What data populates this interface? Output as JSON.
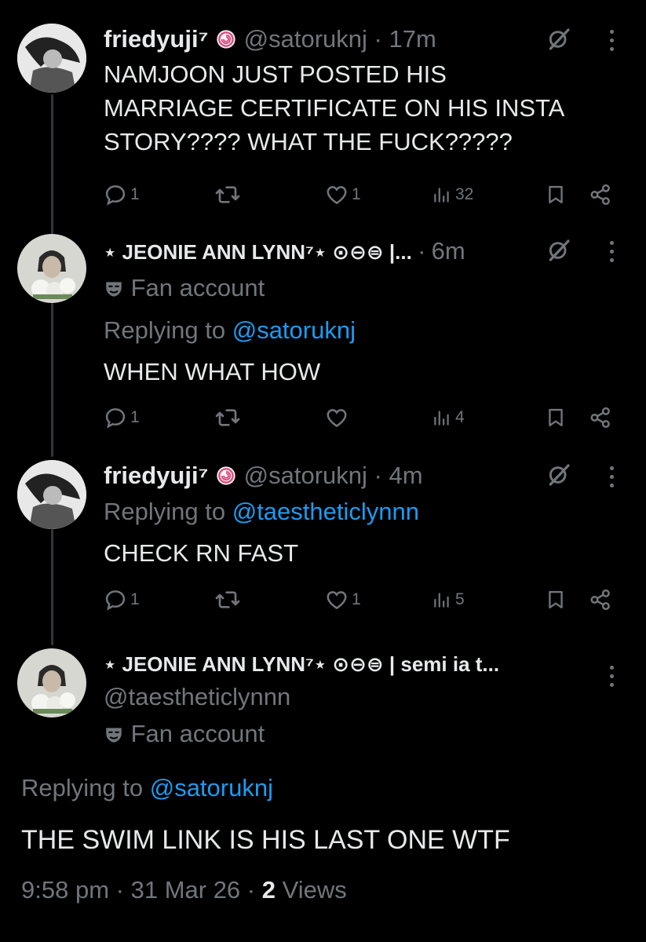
{
  "tweets": [
    {
      "display_name": "friedyuji⁷",
      "handle": "@satoruknj",
      "time_sep": "·",
      "time": "17m",
      "text_lines": [
        "NAMJOON JUST POSTED HIS",
        "MARRIAGE CERTIFICATE ON HIS INSTA",
        "STORY???? WHAT THE FUCK?????"
      ],
      "replies": "1",
      "likes": "1",
      "views": "32"
    },
    {
      "display_name": "⋆ JEONIE ANN LYNN⁷⋆ ⊙⊖⊜ |...",
      "time_sep": "·",
      "time": "6m",
      "label": "Fan account",
      "replying_prefix": "Replying to ",
      "replying_handle": "@satoruknj",
      "text": "WHEN WHAT HOW",
      "replies": "1",
      "views": "4"
    },
    {
      "display_name": "friedyuji⁷",
      "handle": "@satoruknj",
      "time_sep": "·",
      "time": "4m",
      "replying_prefix": "Replying to ",
      "replying_handle": "@taestheticlynnn",
      "text": "CHECK RN FAST",
      "replies": "1",
      "likes": "1",
      "views": "5"
    }
  ],
  "main": {
    "display_name": "⋆ JEONIE ANN LYNN⁷⋆ ⊙⊖⊜ | semi ia t...",
    "handle": "@taestheticlynnn",
    "label": "Fan account",
    "replying_prefix": "Replying to ",
    "replying_handle": "@satoruknj",
    "text": "THE SWIM LINK IS HIS LAST ONE WTF",
    "time": "9:58 pm",
    "sep1": "·",
    "date": "31 Mar 26",
    "sep2": "·",
    "views_count": "2",
    "views_label": "Views"
  },
  "icons": {
    "reply": "reply-icon",
    "retweet": "retweet-icon",
    "like": "heart-icon",
    "views": "views-icon",
    "bookmark": "bookmark-icon",
    "share": "share-icon",
    "grok": "grok-icon",
    "more": "more-icon",
    "fan_badge": "theater-masks-icon",
    "swirl_badge": "swirl-badge-icon"
  },
  "colors": {
    "background": "#000000",
    "text": "#e7e9ea",
    "muted": "#71767b",
    "link": "#1d9bf0",
    "thread": "#333639"
  }
}
